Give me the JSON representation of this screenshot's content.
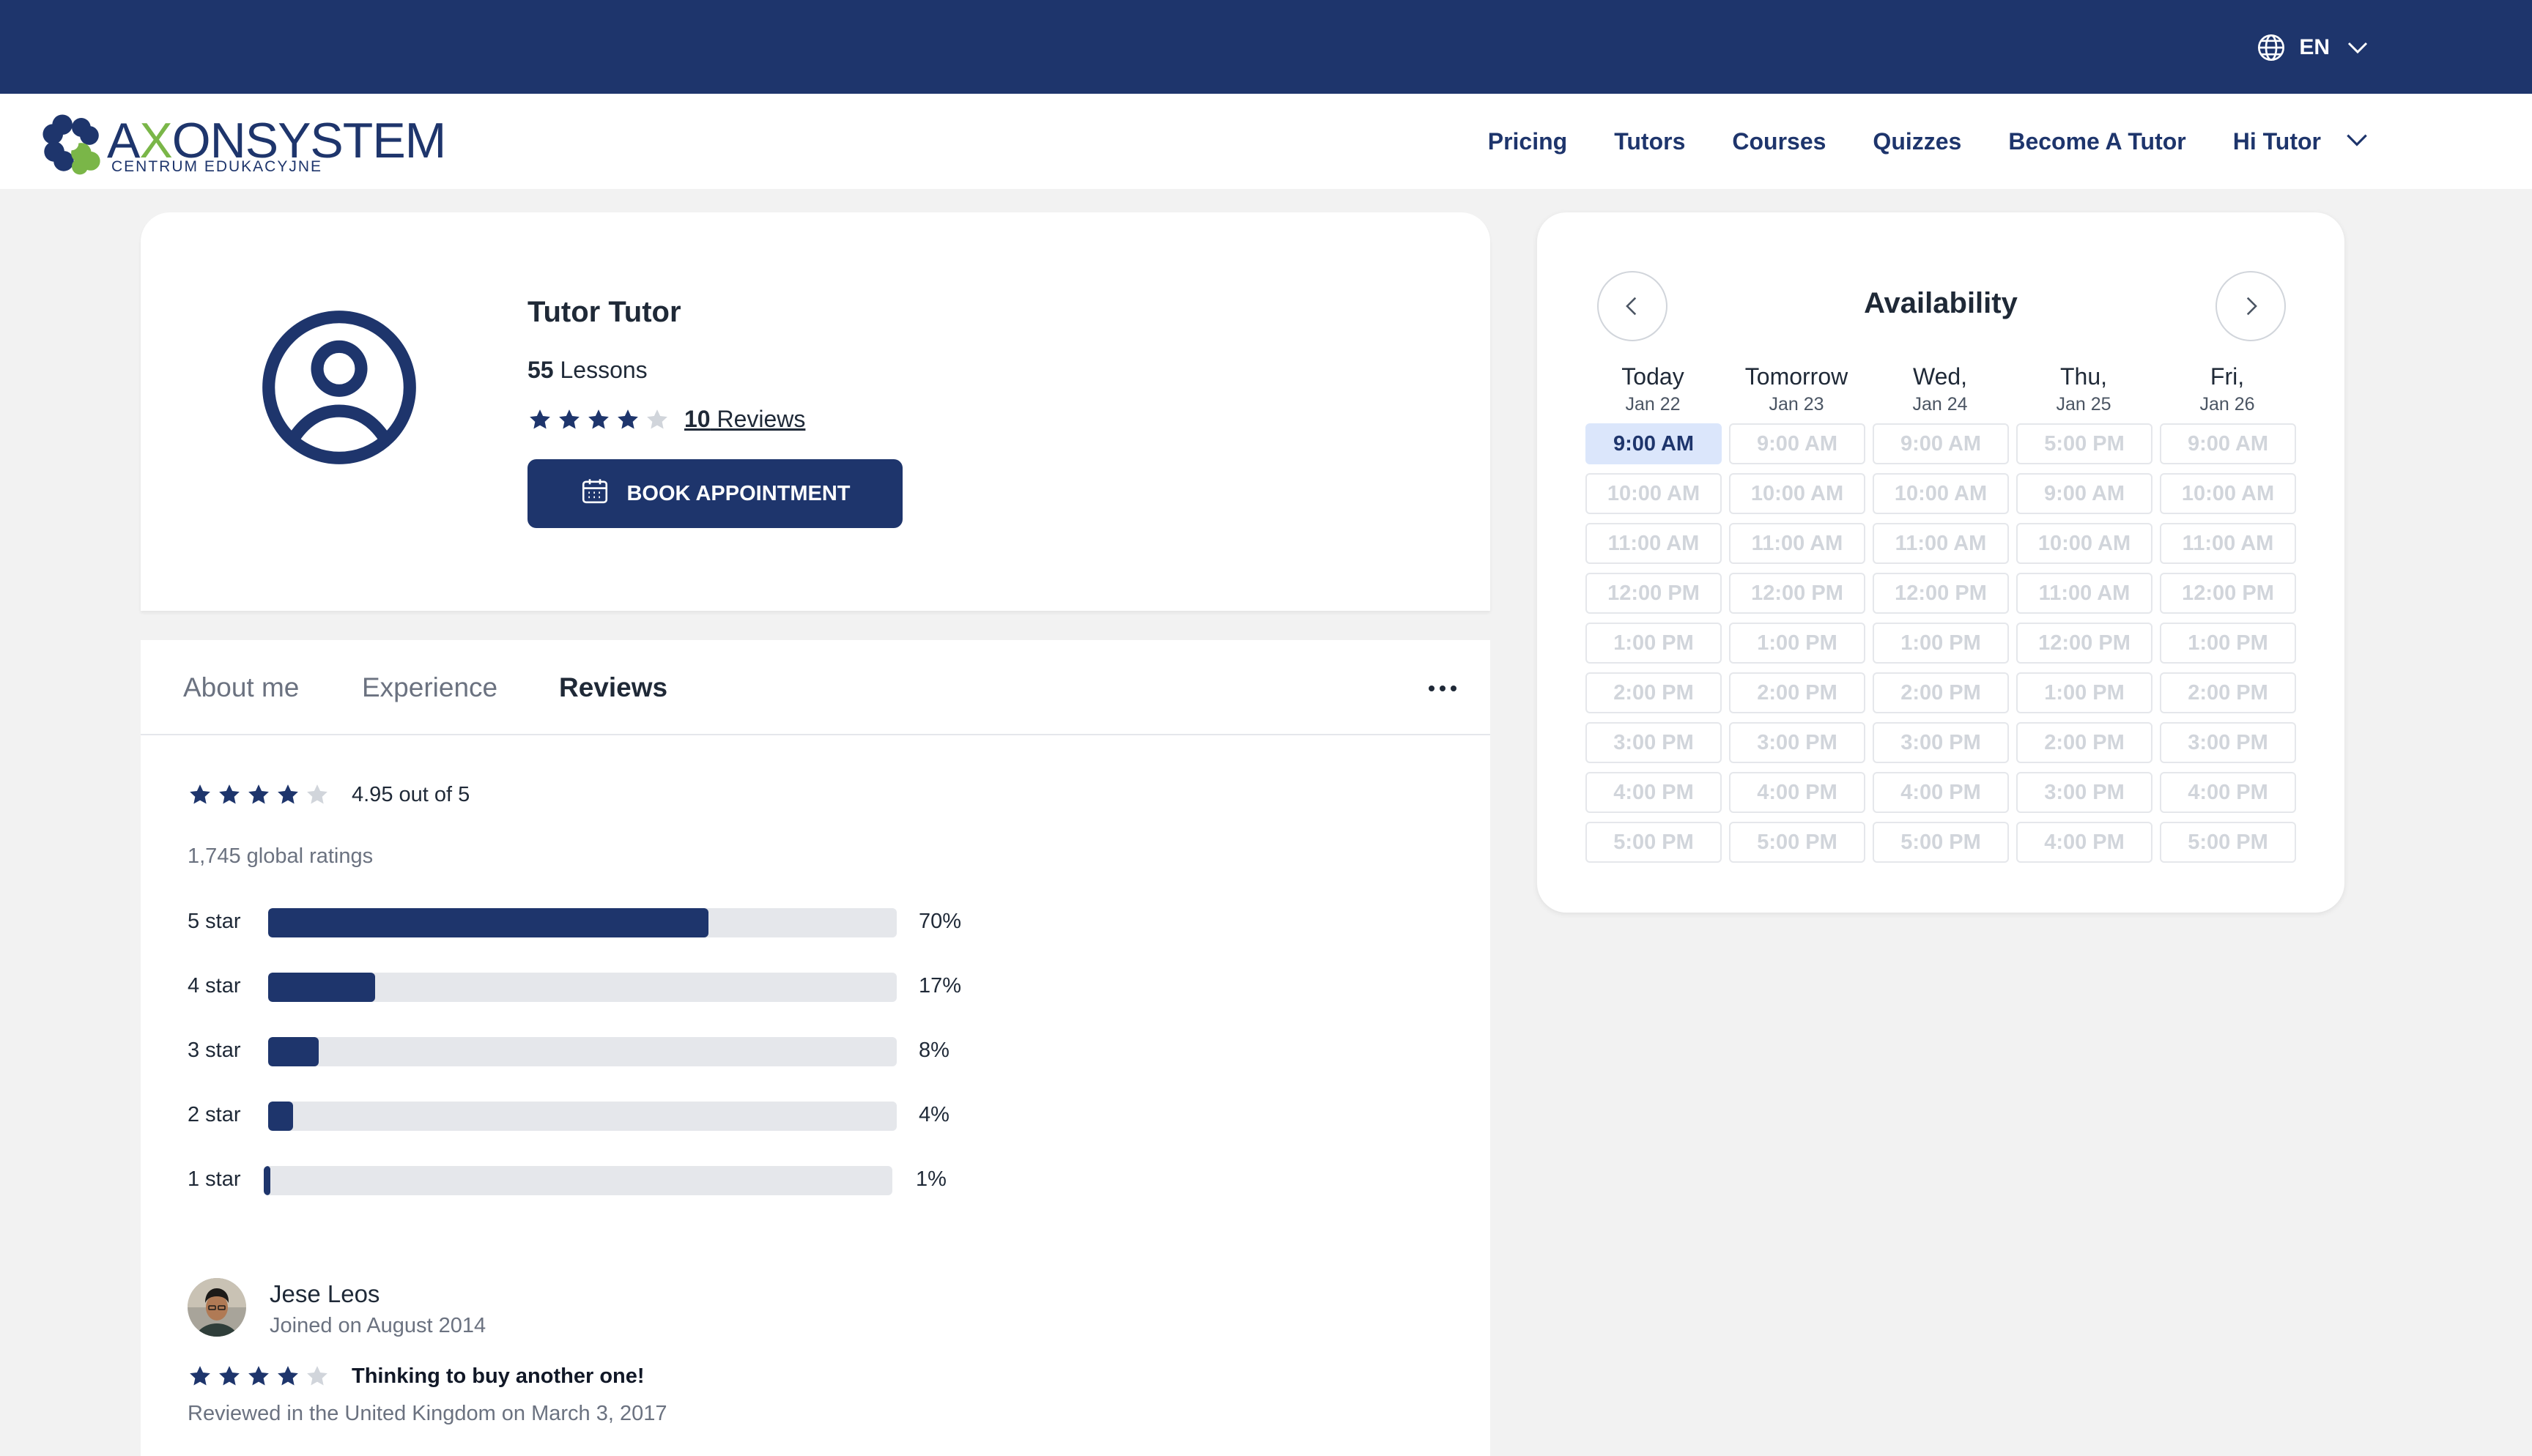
{
  "topbar": {
    "language": "EN",
    "bg_color": "#1e356c"
  },
  "logo": {
    "brand_ax": "A",
    "brand_x": "X",
    "brand_on": "ON",
    "brand_system": "SYSTEM",
    "subtitle": "CENTRUM  EDUKACYJNE"
  },
  "nav": {
    "links": [
      "Pricing",
      "Tutors",
      "Courses",
      "Quizzes",
      "Become A Tutor"
    ],
    "user_label": "Hi Tutor"
  },
  "profile": {
    "name": "Tutor Tutor",
    "lessons_count": "55",
    "lessons_label": " Lessons",
    "rating_stars": 4,
    "reviews_count": "10",
    "reviews_label": " Reviews",
    "book_label": "BOOK APPOINTMENT"
  },
  "tabs": {
    "items": [
      "About me",
      "Experience",
      "Reviews"
    ],
    "active": "Reviews"
  },
  "ratings": {
    "stars": 4,
    "summary": "4.95 out of 5",
    "global": "1,745 global ratings",
    "histogram": [
      {
        "label": "5 star",
        "percent": 70,
        "percent_label": "70%"
      },
      {
        "label": "4 star",
        "percent": 17,
        "percent_label": "17%"
      },
      {
        "label": "3 star",
        "percent": 8,
        "percent_label": "8%"
      },
      {
        "label": "2 star",
        "percent": 4,
        "percent_label": "4%"
      },
      {
        "label": "1 star",
        "percent": 1,
        "percent_label": "1%"
      }
    ]
  },
  "review": {
    "author": "Jese Leos",
    "joined": "Joined on August 2014",
    "stars": 4,
    "title": "Thinking to buy another one!",
    "meta": "Reviewed in the United Kingdom on March 3, 2017"
  },
  "availability": {
    "title": "Availability",
    "days": [
      {
        "name": "Today",
        "date": "Jan 22",
        "slots": [
          "9:00 AM",
          "10:00 AM",
          "11:00 AM",
          "12:00 PM",
          "1:00 PM",
          "2:00 PM",
          "3:00 PM",
          "4:00 PM",
          "5:00 PM"
        ]
      },
      {
        "name": "Tomorrow",
        "date": "Jan 23",
        "slots": [
          "9:00 AM",
          "10:00 AM",
          "11:00 AM",
          "12:00 PM",
          "1:00 PM",
          "2:00 PM",
          "3:00 PM",
          "4:00 PM",
          "5:00 PM"
        ]
      },
      {
        "name": "Wed,",
        "date": "Jan 24",
        "slots": [
          "9:00 AM",
          "10:00 AM",
          "11:00 AM",
          "12:00 PM",
          "1:00 PM",
          "2:00 PM",
          "3:00 PM",
          "4:00 PM",
          "5:00 PM"
        ]
      },
      {
        "name": "Thu,",
        "date": "Jan 25",
        "slots": [
          "5:00 PM",
          "9:00 AM",
          "10:00 AM",
          "11:00 AM",
          "12:00 PM",
          "1:00 PM",
          "2:00 PM",
          "3:00 PM",
          "4:00 PM"
        ]
      },
      {
        "name": "Fri,",
        "date": "Jan 26",
        "slots": [
          "9:00 AM",
          "10:00 AM",
          "11:00 AM",
          "12:00 PM",
          "1:00 PM",
          "2:00 PM",
          "3:00 PM",
          "4:00 PM",
          "5:00 PM"
        ]
      }
    ],
    "selected_day": 0,
    "selected_slot": 0
  },
  "colors": {
    "primary": "#1e356c",
    "accent_green": "#7ab648",
    "star_empty": "#d1d5db",
    "selected_slot_bg": "#dbe6fb"
  },
  "icons": {
    "globe": "globe-icon",
    "chevron": "chevron-down-icon",
    "calendar": "calendar-icon",
    "user": "user-circle-icon",
    "more": "more-horizontal-icon",
    "prev": "chevron-left-icon",
    "next": "chevron-right-icon",
    "star": "star-icon"
  }
}
